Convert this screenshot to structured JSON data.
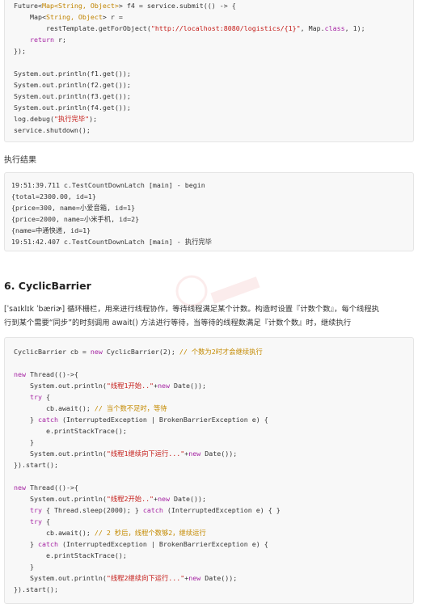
{
  "code_block_1": {
    "lines": [
      [
        {
          "t": "Future<",
          "c": ""
        },
        {
          "t": "Map<String, Object>",
          "c": "ty"
        },
        {
          "t": "> f4 = service.submit(() -> {",
          "c": ""
        }
      ],
      [
        {
          "t": "    Map<",
          "c": ""
        },
        {
          "t": "String, Object",
          "c": "ty"
        },
        {
          "t": "> r =",
          "c": ""
        }
      ],
      [
        {
          "t": "        restTemplate.getForObject(",
          "c": ""
        },
        {
          "t": "\"http://localhost:8080/logistics/{1}\"",
          "c": "str"
        },
        {
          "t": ", Map.",
          "c": ""
        },
        {
          "t": "class",
          "c": "kw"
        },
        {
          "t": ", 1);",
          "c": ""
        }
      ],
      [
        {
          "t": "    ",
          "c": ""
        },
        {
          "t": "return",
          "c": "kw"
        },
        {
          "t": " r;",
          "c": ""
        }
      ],
      [
        {
          "t": "});",
          "c": ""
        }
      ],
      [
        {
          "t": "",
          "c": ""
        }
      ],
      [
        {
          "t": "System.out.println(f1.get());",
          "c": ""
        }
      ],
      [
        {
          "t": "System.out.println(f2.get());",
          "c": ""
        }
      ],
      [
        {
          "t": "System.out.println(f3.get());",
          "c": ""
        }
      ],
      [
        {
          "t": "System.out.println(f4.get());",
          "c": ""
        }
      ],
      [
        {
          "t": "log.debug(",
          "c": ""
        },
        {
          "t": "\"执行完毕\"",
          "c": "str"
        },
        {
          "t": ");",
          "c": ""
        }
      ],
      [
        {
          "t": "service.shutdown();",
          "c": ""
        }
      ]
    ]
  },
  "result_label": "执行结果",
  "code_block_2": {
    "lines": [
      [
        {
          "t": "19:51:39.711 c.TestCountDownLatch [main] - begin",
          "c": ""
        }
      ],
      [
        {
          "t": "{total=2300.00, id=1}",
          "c": ""
        }
      ],
      [
        {
          "t": "{price=300, name=小爱音箱, id=1}",
          "c": ""
        }
      ],
      [
        {
          "t": "{price=2000, name=小米手机, id=2}",
          "c": ""
        }
      ],
      [
        {
          "t": "{name=中通快递, id=1}",
          "c": ""
        }
      ],
      [
        {
          "t": "19:51:42.407 c.TestCountDownLatch [main] - 执行完毕",
          "c": ""
        }
      ]
    ]
  },
  "section_heading": "6. CyclicBarrier",
  "description_line1": "[ˈsaɪklɪk ˈbæriɚ] 循环栅栏，用来进行线程协作，等待线程满足某个计数。构造时设置『计数个数』，每个线程执",
  "description_line2": "行到某个需要“同步”的时刻调用 await() 方法进行等待，当等待的线程数满足『计数个数』时，继续执行",
  "code_block_3": {
    "lines": [
      [
        {
          "t": "CyclicBarrier cb = ",
          "c": ""
        },
        {
          "t": "new",
          "c": "kw"
        },
        {
          "t": " CyclicBarrier(2); ",
          "c": ""
        },
        {
          "t": "// 个数为2时才会继续执行",
          "c": "cm"
        }
      ],
      [
        {
          "t": "",
          "c": ""
        }
      ],
      [
        {
          "t": "new",
          "c": "kw"
        },
        {
          "t": " Thread(()->{",
          "c": ""
        }
      ],
      [
        {
          "t": "    System.out.println(",
          "c": ""
        },
        {
          "t": "\"线程1开始..\"",
          "c": "str"
        },
        {
          "t": "+",
          "c": ""
        },
        {
          "t": "new",
          "c": "kw"
        },
        {
          "t": " Date());",
          "c": ""
        }
      ],
      [
        {
          "t": "    ",
          "c": ""
        },
        {
          "t": "try",
          "c": "kw"
        },
        {
          "t": " {",
          "c": ""
        }
      ],
      [
        {
          "t": "        cb.await(); ",
          "c": ""
        },
        {
          "t": "// 当个数不足时，等待",
          "c": "cm"
        }
      ],
      [
        {
          "t": "    } ",
          "c": ""
        },
        {
          "t": "catch",
          "c": "kw"
        },
        {
          "t": " (InterruptedException | BrokenBarrierException e) {",
          "c": ""
        }
      ],
      [
        {
          "t": "        e.printStackTrace();",
          "c": ""
        }
      ],
      [
        {
          "t": "    }",
          "c": ""
        }
      ],
      [
        {
          "t": "    System.out.println(",
          "c": ""
        },
        {
          "t": "\"线程1继续向下运行...\"",
          "c": "str"
        },
        {
          "t": "+",
          "c": ""
        },
        {
          "t": "new",
          "c": "kw"
        },
        {
          "t": " Date());",
          "c": ""
        }
      ],
      [
        {
          "t": "}).start();",
          "c": ""
        }
      ],
      [
        {
          "t": "",
          "c": ""
        }
      ],
      [
        {
          "t": "new",
          "c": "kw"
        },
        {
          "t": " Thread(()->{",
          "c": ""
        }
      ],
      [
        {
          "t": "    System.out.println(",
          "c": ""
        },
        {
          "t": "\"线程2开始..\"",
          "c": "str"
        },
        {
          "t": "+",
          "c": ""
        },
        {
          "t": "new",
          "c": "kw"
        },
        {
          "t": " Date());",
          "c": ""
        }
      ],
      [
        {
          "t": "    ",
          "c": ""
        },
        {
          "t": "try",
          "c": "kw"
        },
        {
          "t": " { Thread.sleep(2000); } ",
          "c": ""
        },
        {
          "t": "catch",
          "c": "kw"
        },
        {
          "t": " (InterruptedException e) { }",
          "c": ""
        }
      ],
      [
        {
          "t": "    ",
          "c": ""
        },
        {
          "t": "try",
          "c": "kw"
        },
        {
          "t": " {",
          "c": ""
        }
      ],
      [
        {
          "t": "        cb.await(); ",
          "c": ""
        },
        {
          "t": "// 2 秒后，线程个数够2，继续运行",
          "c": "cm"
        }
      ],
      [
        {
          "t": "    } ",
          "c": ""
        },
        {
          "t": "catch",
          "c": "kw"
        },
        {
          "t": " (InterruptedException | BrokenBarrierException e) {",
          "c": ""
        }
      ],
      [
        {
          "t": "        e.printStackTrace();",
          "c": ""
        }
      ],
      [
        {
          "t": "    }",
          "c": ""
        }
      ],
      [
        {
          "t": "    System.out.println(",
          "c": ""
        },
        {
          "t": "\"线程2继续向下运行...\"",
          "c": "str"
        },
        {
          "t": "+",
          "c": ""
        },
        {
          "t": "new",
          "c": "kw"
        },
        {
          "t": " Date());",
          "c": ""
        }
      ],
      [
        {
          "t": "}).start();",
          "c": ""
        }
      ]
    ]
  },
  "colors": {
    "keyword": "#a626a4",
    "type": "#c18401",
    "string": "#c41a16",
    "comment": "#c48a00",
    "code_bg": "#f8f8f8"
  }
}
